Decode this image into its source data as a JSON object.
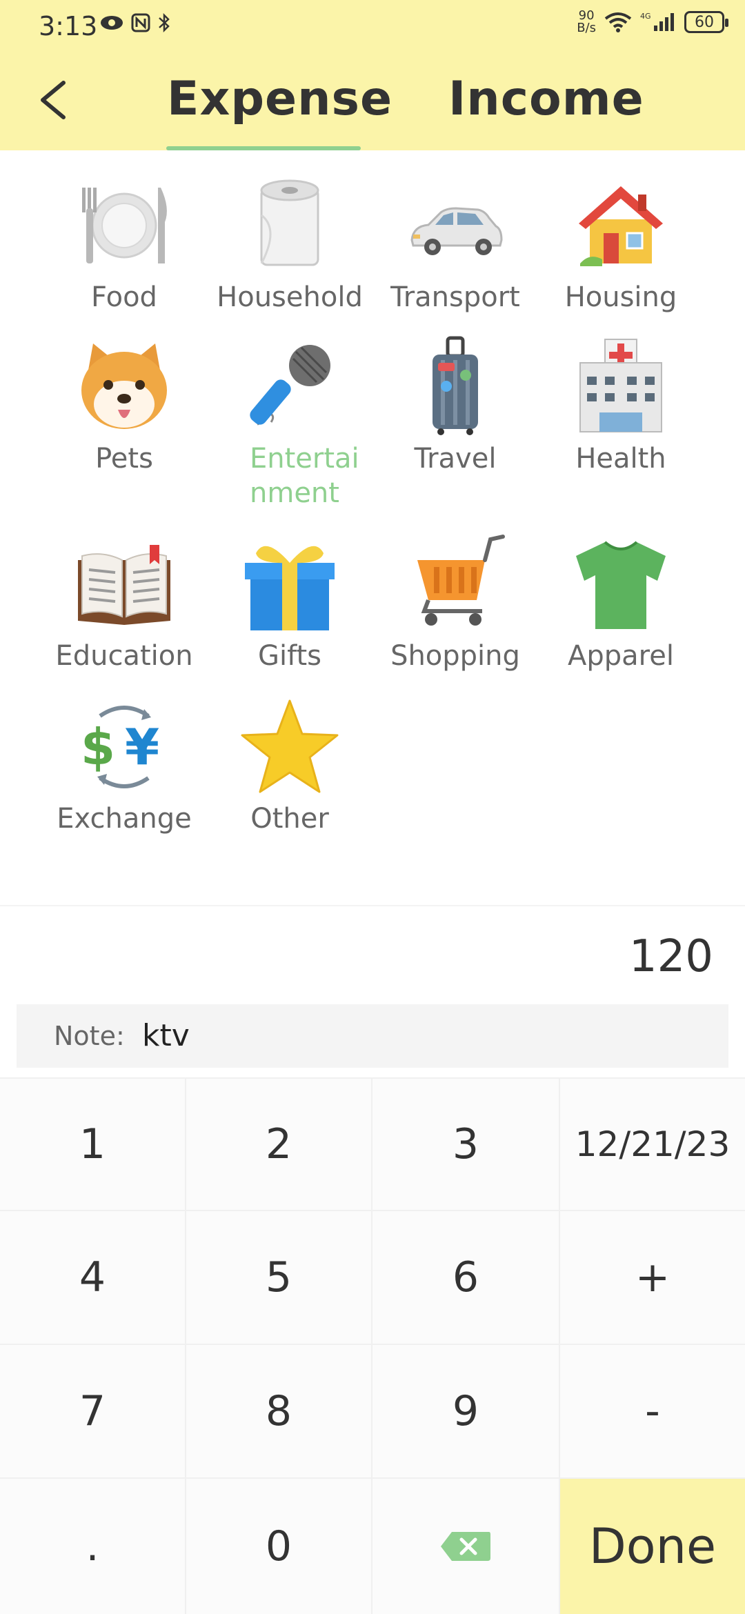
{
  "status": {
    "time": "3:13",
    "net_speed_top": "90",
    "net_speed_bottom": "B/s",
    "signal_label": "4G",
    "battery": "60"
  },
  "tabs": {
    "expense": "Expense",
    "income": "Income"
  },
  "categories": [
    {
      "label": "Food",
      "icon": "plate-icon"
    },
    {
      "label": "Household",
      "icon": "toilet-paper-icon"
    },
    {
      "label": "Transport",
      "icon": "car-icon"
    },
    {
      "label": "Housing",
      "icon": "house-icon"
    },
    {
      "label": "Pets",
      "icon": "dog-face-icon"
    },
    {
      "label": "Entertainment",
      "icon": "microphone-icon"
    },
    {
      "label": "Travel",
      "icon": "luggage-icon"
    },
    {
      "label": "Health",
      "icon": "hospital-icon"
    },
    {
      "label": "Education",
      "icon": "open-book-icon"
    },
    {
      "label": "Gifts",
      "icon": "gift-icon"
    },
    {
      "label": "Shopping",
      "icon": "shopping-cart-icon"
    },
    {
      "label": "Apparel",
      "icon": "tshirt-icon"
    },
    {
      "label": "Exchange",
      "icon": "currency-exchange-icon"
    },
    {
      "label": "Other",
      "icon": "star-icon"
    }
  ],
  "selected_category": "Entertainment",
  "amount": "120",
  "note": {
    "label": "Note:",
    "value": "ktv"
  },
  "keypad": {
    "k1": "1",
    "k2": "2",
    "k3": "3",
    "date": "12/21/23",
    "k4": "4",
    "k5": "5",
    "k6": "6",
    "plus": "+",
    "k7": "7",
    "k8": "8",
    "k9": "9",
    "minus": "-",
    "dot": ".",
    "k0": "0",
    "done": "Done"
  },
  "colors": {
    "header_bg": "#fbf4a9",
    "accent_green": "#8fd08f",
    "done_bg": "#fbf4a9"
  }
}
